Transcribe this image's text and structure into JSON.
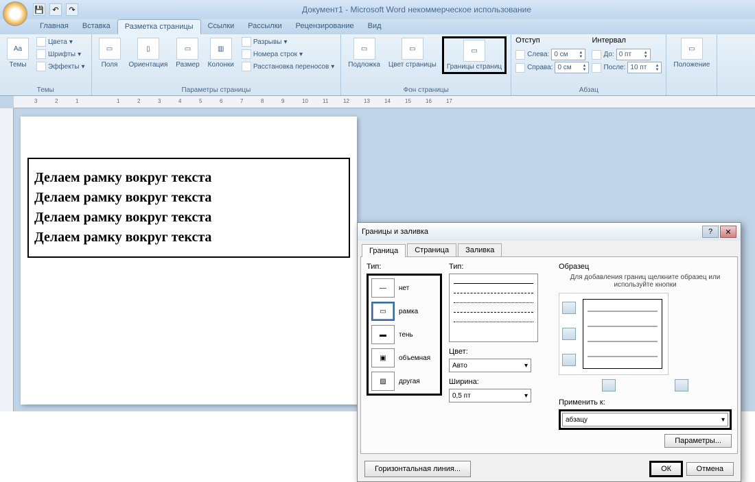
{
  "app": {
    "title": "Документ1 - Microsoft Word некоммерческое использование"
  },
  "qat": {
    "save": "💾",
    "undo": "↶",
    "redo": "↷"
  },
  "tabs": {
    "home": "Главная",
    "insert": "Вставка",
    "layout": "Разметка страницы",
    "refs": "Ссылки",
    "mail": "Рассылки",
    "review": "Рецензирование",
    "view": "Вид"
  },
  "ribbon": {
    "themes": {
      "label": "Темы",
      "btn": "Темы",
      "colors": "Цвета",
      "fonts": "Шрифты",
      "effects": "Эффекты"
    },
    "page": {
      "label": "Параметры страницы",
      "margins": "Поля",
      "orient": "Ориентация",
      "size": "Размер",
      "cols": "Колонки",
      "breaks": "Разрывы",
      "lineno": "Номера строк",
      "hyphen": "Расстановка переносов"
    },
    "bg": {
      "label": "Фон страницы",
      "watermark": "Подложка",
      "color": "Цвет страницы",
      "borders": "Границы страниц"
    },
    "indent": {
      "title": "Отступ",
      "left": "Слева:",
      "left_val": "0 см",
      "right": "Справа:",
      "right_val": "0 см"
    },
    "spacing": {
      "title": "Интервал",
      "before": "До:",
      "before_val": "0 пт",
      "after": "После:",
      "after_val": "10 пт"
    },
    "para": {
      "label": "Абзац"
    },
    "arrange": {
      "pos": "Положение"
    }
  },
  "document": {
    "line1": "Делаем рамку вокруг текста",
    "line2": "Делаем рамку вокруг текста",
    "line3": "Делаем рамку вокруг текста",
    "line4": "Делаем рамку вокруг текста"
  },
  "dialog": {
    "title": "Границы и заливка",
    "tabs": {
      "border": "Граница",
      "page": "Страница",
      "fill": "Заливка"
    },
    "type_label": "Тип:",
    "types": {
      "none": "нет",
      "box": "рамка",
      "shadow": "тень",
      "threeD": "объемная",
      "custom": "другая"
    },
    "style_label": "Тип:",
    "color_label": "Цвет:",
    "color_val": "Авто",
    "width_label": "Ширина:",
    "width_val": "0,5 пт",
    "preview_label": "Образец",
    "preview_hint": "Для добавления границ щелкните образец или используйте кнопки",
    "apply_label": "Применить к:",
    "apply_val": "абзацу",
    "params": "Параметры...",
    "hline": "Горизонтальная линия...",
    "ok": "ОК",
    "cancel": "Отмена",
    "help": "?",
    "close": "✕"
  }
}
